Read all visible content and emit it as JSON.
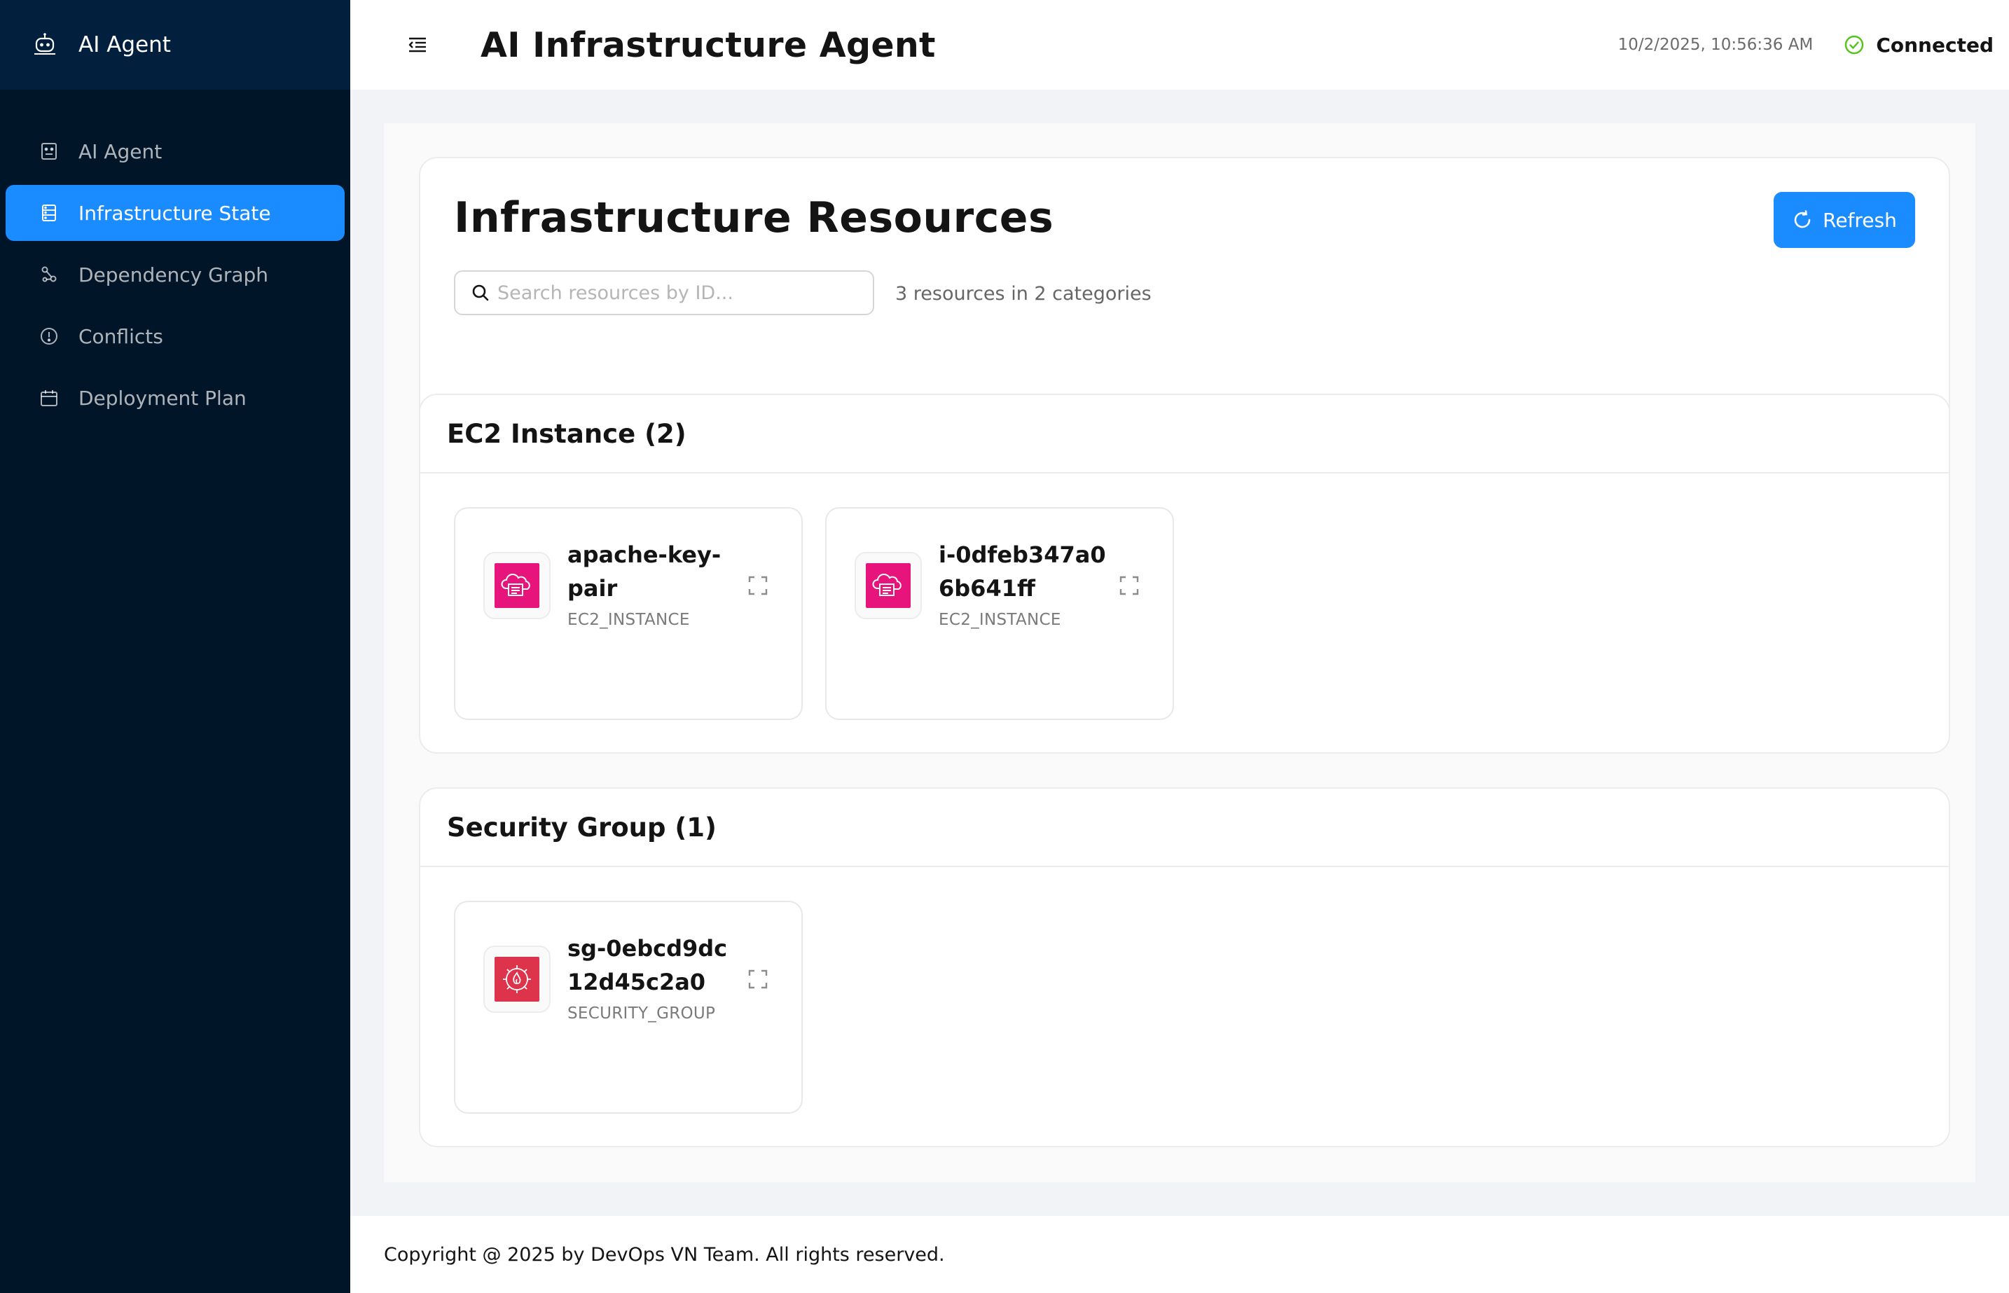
{
  "app": {
    "brand": "AI Agent"
  },
  "sidebar": {
    "items": [
      {
        "label": "AI Agent",
        "icon": "robot-icon",
        "active": false
      },
      {
        "label": "Infrastructure State",
        "icon": "database-icon",
        "active": true
      },
      {
        "label": "Dependency Graph",
        "icon": "graph-icon",
        "active": false
      },
      {
        "label": "Conflicts",
        "icon": "alert-circle-icon",
        "active": false
      },
      {
        "label": "Deployment Plan",
        "icon": "calendar-icon",
        "active": false
      }
    ]
  },
  "header": {
    "title": "AI Infrastructure Agent",
    "timestamp": "10/2/2025, 10:56:36 AM",
    "status": "Connected",
    "status_color": "#52c41a"
  },
  "main": {
    "title": "Infrastructure Resources",
    "refresh_label": "Refresh",
    "search_placeholder": "Search resources by ID...",
    "summary": "3 resources in 2 categories",
    "accent": "#1a8cff"
  },
  "categories": [
    {
      "title": "EC2 Instance (2)",
      "resources": [
        {
          "name": "apache-key-pair",
          "type": "EC2_INSTANCE",
          "icon": "ec2-instance-icon",
          "color": "#e7157b"
        },
        {
          "name": "i-0dfeb347a06b641ff",
          "type": "EC2_INSTANCE",
          "icon": "ec2-instance-icon",
          "color": "#e7157b"
        }
      ]
    },
    {
      "title": "Security Group (1)",
      "resources": [
        {
          "name": "sg-0ebcd9dc12d45c2a0",
          "type": "SECURITY_GROUP",
          "icon": "security-group-icon",
          "color": "#dd344c"
        }
      ]
    }
  ],
  "footer": {
    "text": "Copyright @ 2025 by DevOps VN Team. All rights reserved."
  }
}
